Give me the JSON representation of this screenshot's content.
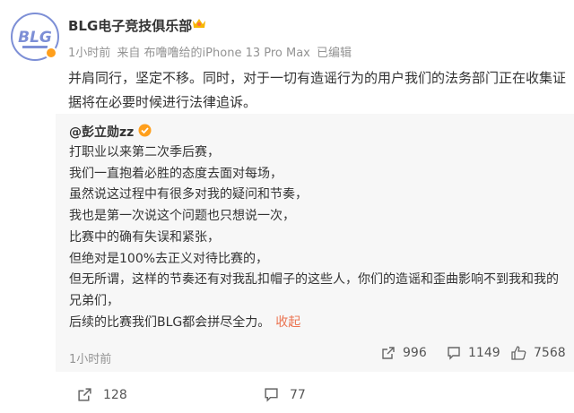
{
  "post": {
    "author": "BLG电子竞技俱乐部",
    "avatar_text": "BLG",
    "meta": {
      "time": "1小时前",
      "source": "来自 布噜噜给的iPhone 13 Pro Max",
      "edited": "已编辑"
    },
    "text": "并肩同行，坚定不移。同时，对于一切有造谣行为的用户我们的法务部门正在收集证据将在必要时候进行法律追诉。"
  },
  "repost": {
    "author": "@彭立勋zz",
    "lines": [
      "打职业以来第二次季后赛，",
      "我们一直抱着必胜的态度去面对每场，",
      "虽然说这过程中有很多对我的疑问和节奏，",
      "我也是第一次说这个问题也只想说一次，",
      "比赛中的确有失误和紧张，",
      "但绝对是100%去正义对待比赛的，",
      "但无所谓，这样的节奏还有对我乱扣帽子的这些人，你们的造谣和歪曲影响不到我和我的兄弟们，",
      "后续的比赛我们BLG都会拼尽全力。"
    ],
    "collapse_label": "收起",
    "time": "1小时前",
    "stats": {
      "reposts": "996",
      "comments": "1149",
      "likes": "7568"
    }
  },
  "footer": {
    "reposts": "128",
    "comments": "77"
  },
  "icons": {
    "verified_badge": "verified-badge-icon",
    "crown": "crown-icon",
    "repost": "repost-icon",
    "comment": "comment-icon",
    "like": "thumbs-up-icon"
  },
  "colors": {
    "accent": "#eb7350",
    "meta": "#939393",
    "repost_bg": "#f7f7f7",
    "verified": "#ff9f1c"
  }
}
